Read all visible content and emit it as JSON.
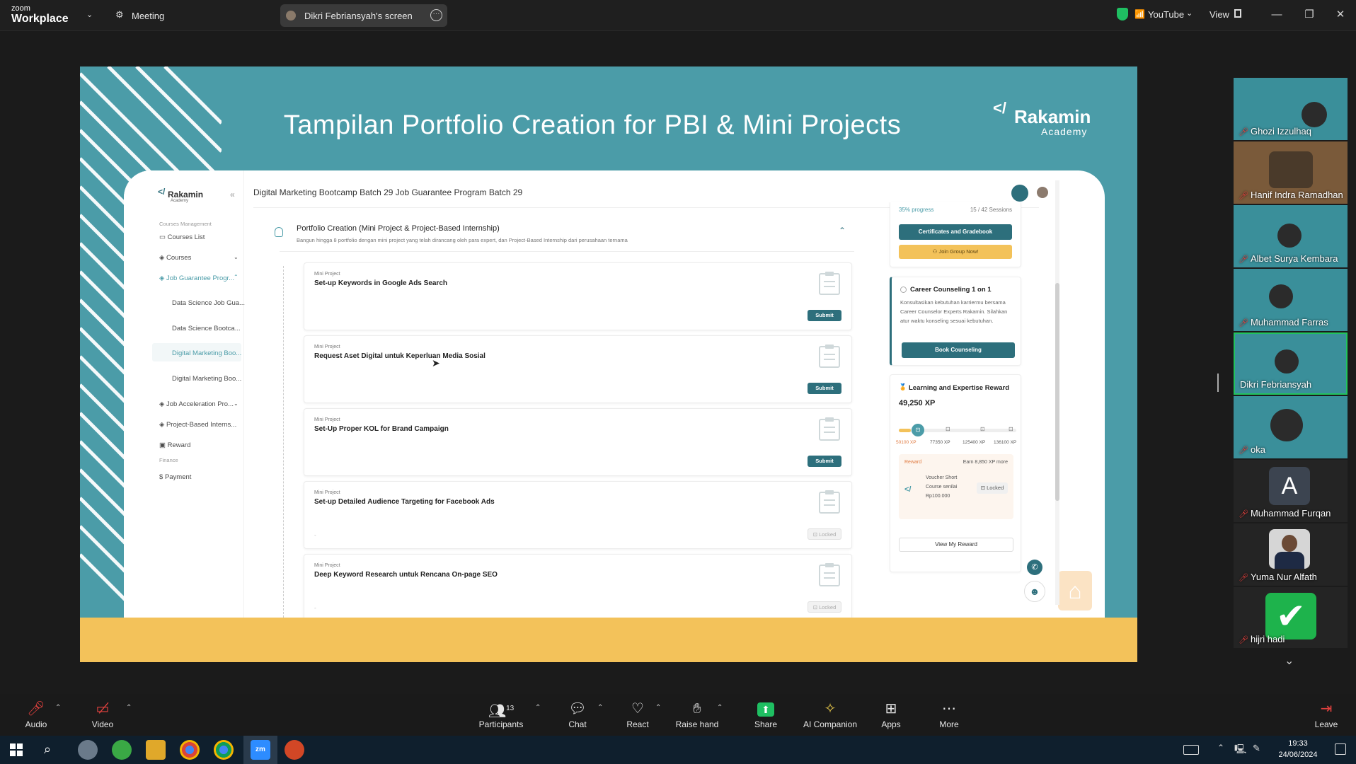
{
  "app": {
    "brand_small": "zoom",
    "brand_big": "Workplace",
    "meeting_label": "Meeting",
    "screen_tab": "Dikri Febriansyah's screen",
    "youtube_label": "YouTube",
    "view_label": "View"
  },
  "slide": {
    "title": "Tampilan Portfolio Creation for PBI & Mini Projects",
    "logo_name": "Rakamin",
    "logo_sub": "Academy"
  },
  "lms": {
    "header_title": "Digital Marketing Bootcamp Batch 29 Job Guarantee Program Batch 29",
    "logo_name": "Rakamin",
    "logo_sub": "Academy",
    "sidebar": {
      "section_courses": "Courses Management",
      "courses_list": "Courses List",
      "courses": "Courses",
      "job_guarantee": "Job Guarantee Progr...",
      "sub1": "Data Science Job Gua...",
      "sub2": "Data Science Bootca...",
      "sub3": "Digital Marketing Boo...",
      "sub4": "Digital Marketing Boo...",
      "job_acceleration": "Job Acceleration Pro...",
      "pbi": "Project-Based Interns...",
      "reward": "Reward",
      "section_finance": "Finance",
      "payment": "Payment"
    },
    "section": {
      "title": "Portfolio Creation (Mini Project & Project-Based Internship)",
      "desc": "Bangun hingga 8 portfolio dengan mini project yang telah dirancang oleh para expert, dan Project-Based Internship dari perusahaan ternama"
    },
    "projects": [
      {
        "tag": "Mini Project",
        "title": "Set-up Keywords in Google Ads Search",
        "button": "Submit",
        "state": "open"
      },
      {
        "tag": "Mini Project",
        "title": "Request Aset Digital untuk Keperluan Media Sosial",
        "button": "Submit",
        "state": "open"
      },
      {
        "tag": "Mini Project",
        "title": "Set-Up Proper KOL for Brand Campaign",
        "button": "Submit",
        "state": "open"
      },
      {
        "tag": "Mini Project",
        "title": "Set-up Detailed Audience Targeting for Facebook Ads",
        "button": "Locked",
        "state": "locked",
        "dash": "-"
      },
      {
        "tag": "Mini Project",
        "title": "Deep Keyword Research untuk Rencana On-page SEO",
        "button": "Locked",
        "state": "locked",
        "dash": "-"
      }
    ],
    "progress": {
      "label": "35% progress",
      "sessions": "15 / 42 Sessions"
    },
    "certificates_btn": "Certificates and Gradebook",
    "join_group_btn": "Join Group Now!",
    "counseling": {
      "title": "Career Counseling 1 on 1",
      "desc": "Konsultasikan kebutuhan karriermu bersama Career Counselor Experts Rakamin. Silahkan atur waktu konseling sesuai kebutuhan.",
      "button": "Book Counseling"
    },
    "reward": {
      "title": "Learning and Expertise Reward",
      "xp": "49,250 XP",
      "milestones": [
        "50100 XP",
        "77350 XP",
        "125400 XP",
        "136100 XP"
      ],
      "progress_fraction": 0.1,
      "reward_label": "Reward",
      "earn_more": "Earn 8,850 XP more",
      "voucher_line1": "Voucher Short",
      "voucher_line2": "Course senilai",
      "voucher_line3": "Rp100.000",
      "locked": "Locked",
      "view_btn": "View My Reward"
    }
  },
  "participants": [
    {
      "name": "Ghozi Izzulhaq",
      "muted": true,
      "bg": "#3a8f9a"
    },
    {
      "name": "Hanif Indra Ramadhan",
      "muted": true,
      "bg": "#7a5a3a"
    },
    {
      "name": "Albet Surya Kembara",
      "muted": true,
      "bg": "#3a8f9a"
    },
    {
      "name": "Muhammad Farras",
      "muted": true,
      "bg": "#3a8f9a"
    },
    {
      "name": "Dikri Febriansyah",
      "muted": false,
      "bg": "#3a8f9a",
      "active": true
    },
    {
      "name": "oka",
      "muted": true,
      "bg": "#3a8f9a"
    },
    {
      "name": "Muhammad Furqan",
      "muted": true,
      "bg": "#242424",
      "initial": "A"
    },
    {
      "name": "Yuma Nur Alfath",
      "muted": true,
      "bg": "#242424"
    },
    {
      "name": "hijri hadi",
      "muted": true,
      "bg": "#242424"
    }
  ],
  "toolbar": {
    "audio": "Audio",
    "video": "Video",
    "participants": "Participants",
    "participants_count": "13",
    "chat": "Chat",
    "react": "React",
    "raise_hand": "Raise hand",
    "share": "Share",
    "ai_companion": "AI Companion",
    "apps": "Apps",
    "more": "More",
    "leave": "Leave"
  },
  "taskbar": {
    "time": "19:33",
    "date": "24/06/2024"
  },
  "colors": {
    "teal": "#4b9ca8",
    "dark_teal": "#2d6f7c",
    "yellow": "#f3c25a",
    "green_share": "#1fbf62",
    "red_mute": "#e0413e"
  }
}
